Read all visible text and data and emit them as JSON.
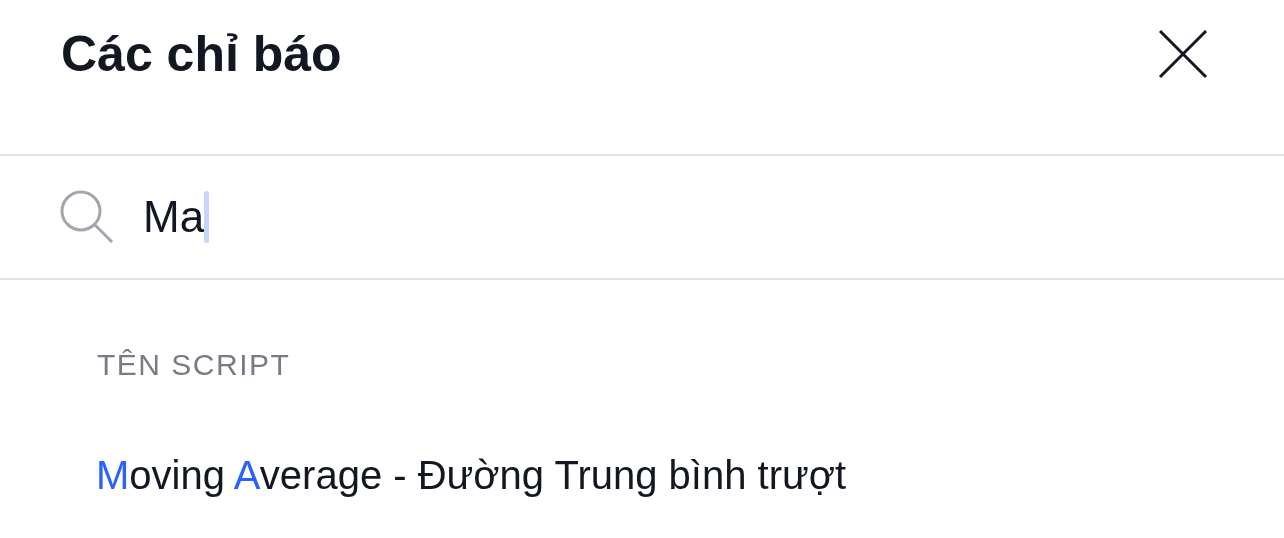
{
  "title": "Các chỉ báo",
  "search": {
    "value": "Ma"
  },
  "section_label": "TÊN SCRIPT",
  "results": [
    {
      "parts": [
        {
          "text": "M",
          "highlighted": true
        },
        {
          "text": "oving ",
          "highlighted": false
        },
        {
          "text": "A",
          "highlighted": true
        },
        {
          "text": "verage - Đường Trung bình trượt",
          "highlighted": false
        }
      ]
    }
  ]
}
